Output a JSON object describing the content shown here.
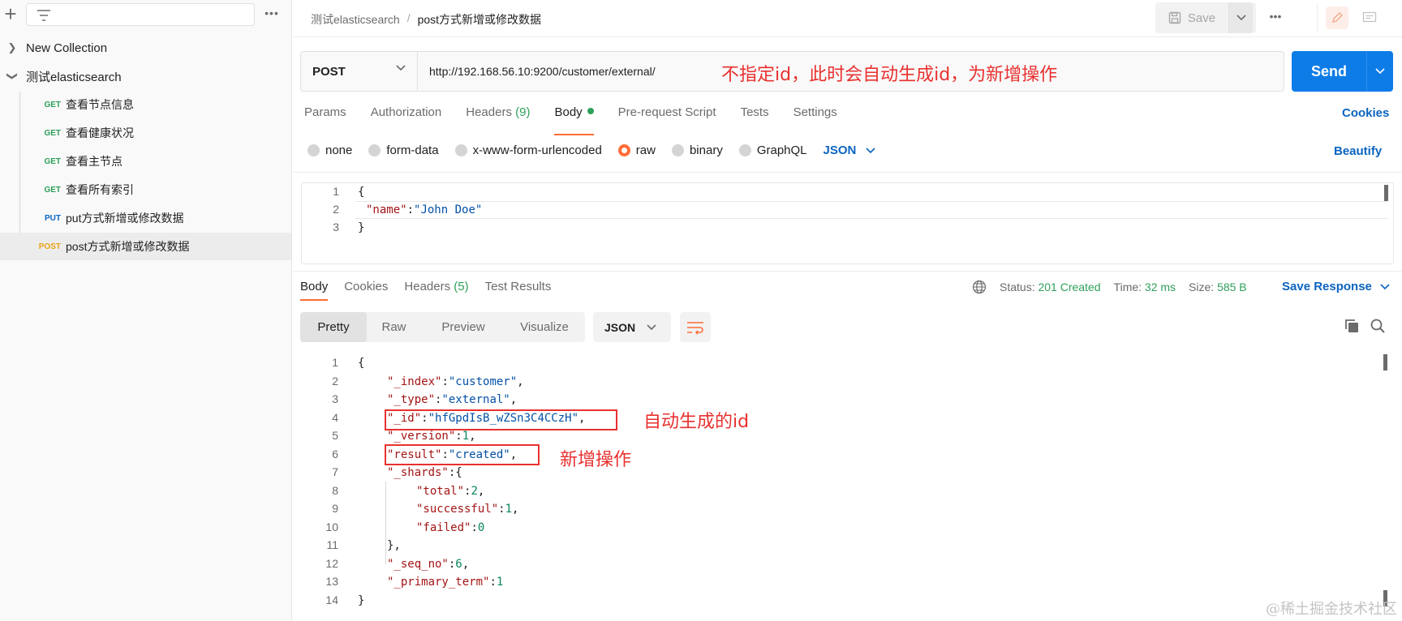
{
  "sidebar": {
    "collections": [
      {
        "label": "New Collection",
        "expanded": false
      },
      {
        "label": "测试elasticsearch",
        "expanded": true
      }
    ],
    "requests": [
      {
        "method": "GET",
        "label": "查看节点信息"
      },
      {
        "method": "GET",
        "label": "查看健康状况"
      },
      {
        "method": "GET",
        "label": "查看主节点"
      },
      {
        "method": "GET",
        "label": "查看所有索引"
      },
      {
        "method": "PUT",
        "label": "put方式新增或修改数据"
      },
      {
        "method": "POST",
        "label": "post方式新增或修改数据"
      }
    ]
  },
  "header": {
    "collection": "测试elasticsearch",
    "separator": "/",
    "request_name": "post方式新增或修改数据",
    "save_label": "Save"
  },
  "request": {
    "method": "POST",
    "url": "http://192.168.56.10:9200/customer/external/",
    "send_label": "Send",
    "annotation": "不指定id，此时会自动生成id，为新增操作",
    "tabs": {
      "params": "Params",
      "authorization": "Authorization",
      "headers": "Headers",
      "headers_count": "(9)",
      "body": "Body",
      "prerequest": "Pre-request Script",
      "tests": "Tests",
      "settings": "Settings"
    },
    "cookies_label": "Cookies",
    "body_types": {
      "none": "none",
      "form_data": "form-data",
      "urlencoded": "x-www-form-urlencoded",
      "raw": "raw",
      "binary": "binary",
      "graphql": "GraphQL"
    },
    "body_format": "JSON",
    "beautify_label": "Beautify",
    "body_lines": {
      "n1": "1",
      "n2": "2",
      "n3": "3",
      "l1": "{",
      "l2_key": "\"name\"",
      "l2_colon": ":",
      "l2_val": "\"John Doe\"",
      "l3": "}"
    }
  },
  "response": {
    "tabs": {
      "body": "Body",
      "cookies": "Cookies",
      "headers": "Headers",
      "headers_count": "(5)",
      "test_results": "Test Results"
    },
    "status_label": "Status:",
    "status_value": "201 Created",
    "time_label": "Time:",
    "time_value": "32 ms",
    "size_label": "Size:",
    "size_value": "585 B",
    "save_response_label": "Save Response",
    "view_tabs": {
      "pretty": "Pretty",
      "raw": "Raw",
      "preview": "Preview",
      "visualize": "Visualize"
    },
    "format": "JSON",
    "annotations": {
      "id": "自动生成的id",
      "result": "新增操作"
    },
    "lines": [
      {
        "n": "1",
        "key": "",
        "val": "{",
        "tail": ""
      },
      {
        "n": "2",
        "key": "\"_index\"",
        "val": "\"customer\"",
        "tail": ","
      },
      {
        "n": "3",
        "key": "\"_type\"",
        "val": "\"external\"",
        "tail": ","
      },
      {
        "n": "4",
        "key": "\"_id\"",
        "val": "\"hfGpdIsB_wZSn3C4CCzH\"",
        "tail": ","
      },
      {
        "n": "5",
        "key": "\"_version\"",
        "val": "1",
        "tail": ","
      },
      {
        "n": "6",
        "key": "\"result\"",
        "val": "\"created\"",
        "tail": ","
      },
      {
        "n": "7",
        "key": "\"_shards\"",
        "val": "{",
        "tail": ""
      },
      {
        "n": "8",
        "key": "\"total\"",
        "val": "2",
        "tail": ","
      },
      {
        "n": "9",
        "key": "\"successful\"",
        "val": "1",
        "tail": ","
      },
      {
        "n": "10",
        "key": "\"failed\"",
        "val": "0",
        "tail": ""
      },
      {
        "n": "11",
        "key": "",
        "val": "},",
        "tail": ""
      },
      {
        "n": "12",
        "key": "\"_seq_no\"",
        "val": "6",
        "tail": ","
      },
      {
        "n": "13",
        "key": "\"_primary_term\"",
        "val": "1",
        "tail": ""
      },
      {
        "n": "14",
        "key": "",
        "val": "}",
        "tail": ""
      }
    ]
  },
  "watermark": "@稀土掘金技术社区",
  "colors": {
    "accent": "#ff6c37",
    "send": "#0e7ce7",
    "link": "#0b64c0",
    "success": "#2fa05b",
    "annotation": "#e8312f",
    "get": "#2fa05b",
    "put": "#0b64c0",
    "post": "#e8a317"
  }
}
